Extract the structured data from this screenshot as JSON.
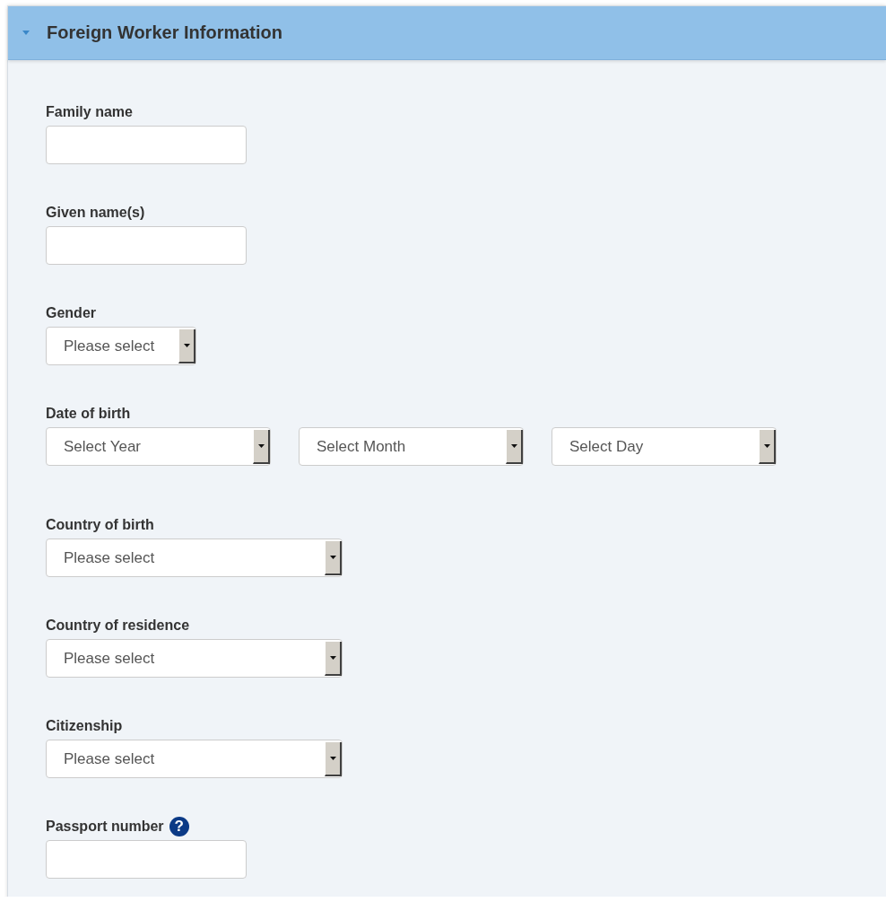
{
  "panel": {
    "title": "Foreign Worker Information",
    "expanded": true
  },
  "fields": [
    {
      "label": "Family name",
      "kind": "text"
    },
    {
      "label": "Given name(s)",
      "kind": "text"
    },
    {
      "label": "Gender",
      "kind": "short-select",
      "selects": [
        "Please select"
      ]
    },
    {
      "label": "Date of birth",
      "kind": "date",
      "selects": [
        "Select Year",
        "Select Month",
        "Select Day"
      ]
    },
    {
      "label": "Country of birth",
      "kind": "select",
      "selects": [
        "Please select"
      ]
    },
    {
      "label": "Country of residence",
      "kind": "select",
      "selects": [
        "Please select"
      ]
    },
    {
      "label": "Citizenship",
      "kind": "select",
      "selects": [
        "Please select"
      ]
    },
    {
      "label": "Passport number",
      "kind": "text",
      "help": "?"
    }
  ]
}
